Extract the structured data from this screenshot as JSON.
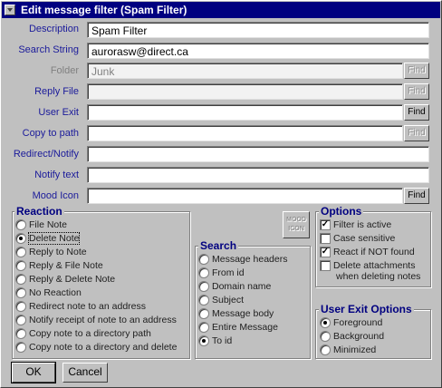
{
  "window": {
    "title": "Edit message filter (Spam Filter)"
  },
  "fields": [
    {
      "label": "Description",
      "value": "Spam Filter",
      "enabled": true,
      "find": null
    },
    {
      "label": "Search String",
      "value": "aurorasw@direct.ca",
      "enabled": true,
      "find": null
    },
    {
      "label": "Folder",
      "value": "Junk",
      "enabled": false,
      "find": "Find",
      "find_enabled": false
    },
    {
      "label": "Reply File",
      "value": "",
      "enabled": false,
      "find": "Find",
      "find_enabled": false
    },
    {
      "label": "User Exit",
      "value": "",
      "enabled": true,
      "find": "Find",
      "find_enabled": true
    },
    {
      "label": "Copy to path",
      "value": "",
      "enabled": true,
      "find": "Find",
      "find_enabled": false
    },
    {
      "label": "Redirect/Notify",
      "value": "",
      "enabled": true,
      "find": null
    },
    {
      "label": "Notify text",
      "value": "",
      "enabled": true,
      "find": null
    },
    {
      "label": "Mood Icon",
      "value": "",
      "enabled": true,
      "find": "Find",
      "find_enabled": true
    }
  ],
  "reaction": {
    "title": "Reaction",
    "selected": 1,
    "items": [
      "File Note",
      "Delete Note",
      "Reply to Note",
      "Reply & File Note",
      "Reply & Delete Note",
      "No Reaction",
      "Redirect note to an address",
      "Notify receipt of note to an address",
      "Copy note to a directory path",
      "Copy note to a directory and delete"
    ]
  },
  "mood_button": {
    "line1": "MOOD",
    "line2": "ICON"
  },
  "search": {
    "title": "Search",
    "selected": 6,
    "items": [
      "Message headers",
      "From id",
      "Domain name",
      "Subject",
      "Message body",
      "Entire Message",
      "To id"
    ]
  },
  "options": {
    "title": "Options",
    "items": [
      {
        "label": "Filter is active",
        "checked": true
      },
      {
        "label": "Case sensitive",
        "checked": false
      },
      {
        "label": "React if NOT found",
        "checked": true
      },
      {
        "label": "Delete attachments",
        "label2": "when deleting notes",
        "checked": false
      }
    ]
  },
  "user_exit_options": {
    "title": "User Exit Options",
    "selected": 0,
    "items": [
      "Foreground",
      "Background",
      "Minimized"
    ]
  },
  "buttons": {
    "ok": "OK",
    "cancel": "Cancel"
  }
}
